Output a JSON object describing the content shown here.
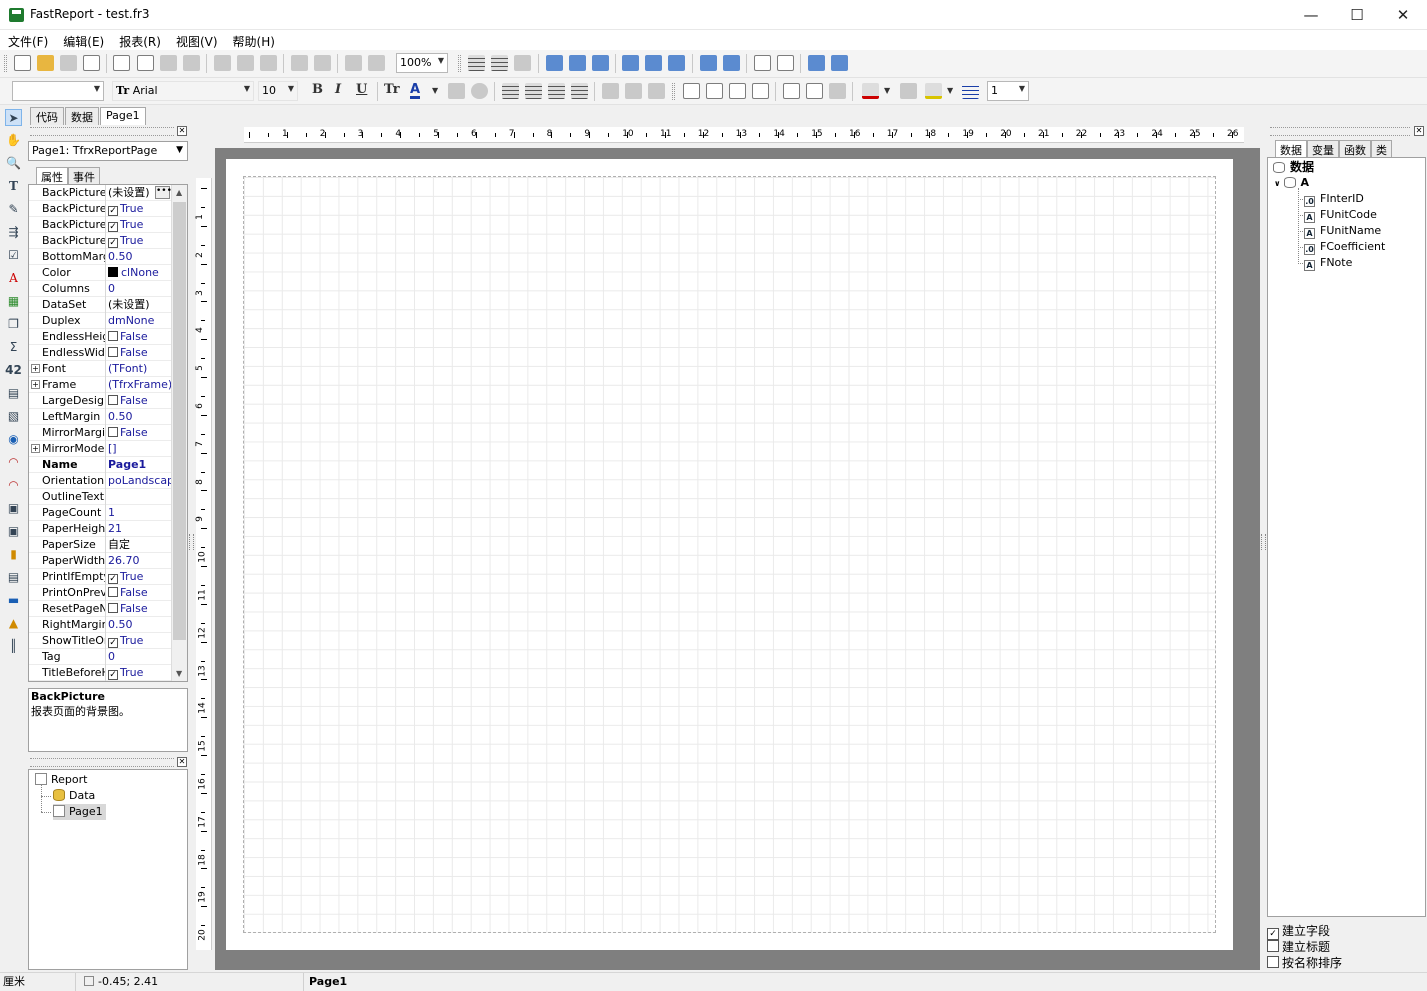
{
  "window": {
    "title": "FastReport - test.fr3"
  },
  "menu": [
    "文件(F)",
    "编辑(E)",
    "报表(R)",
    "视图(V)",
    "帮助(H)"
  ],
  "toolbar": {
    "zoom": "100%",
    "font_name": "Arial",
    "font_size": "10",
    "line_width": "1",
    "style_combo": ""
  },
  "page_tabs": [
    "代码",
    "数据",
    "Page1"
  ],
  "inspector": {
    "object_selector": "Page1: TfrxReportPage",
    "tabs": [
      "属性",
      "事件"
    ],
    "properties": [
      {
        "name": "BackPicture",
        "value": "(未设置)",
        "ellipsis": true
      },
      {
        "name": "BackPictureP",
        "value": "True",
        "check": true
      },
      {
        "name": "BackPictureS",
        "value": "True",
        "check": true
      },
      {
        "name": "BackPictureVi",
        "value": "True",
        "check": true
      },
      {
        "name": "BottomMargin",
        "value": "0.50"
      },
      {
        "name": "Color",
        "value": "clNone",
        "swatch": true
      },
      {
        "name": "Columns",
        "value": "0"
      },
      {
        "name": "DataSet",
        "value": "(未设置)"
      },
      {
        "name": "Duplex",
        "value": "dmNone"
      },
      {
        "name": "EndlessHeigh",
        "value": "False",
        "check": false
      },
      {
        "name": "EndlessWidth",
        "value": "False",
        "check": false
      },
      {
        "name": "Font",
        "value": "(TFont)",
        "expand": true
      },
      {
        "name": "Frame",
        "value": "(TfrxFrame)",
        "expand": true
      },
      {
        "name": "LargeDesignH",
        "value": "False",
        "check": false
      },
      {
        "name": "LeftMargin",
        "value": "0.50"
      },
      {
        "name": "MirrorMargins",
        "value": "False",
        "check": false
      },
      {
        "name": "MirrorMode",
        "value": "[]",
        "expand": true
      },
      {
        "name": "Name",
        "value": "Page1",
        "bold": true
      },
      {
        "name": "Orientation",
        "value": "poLandscape"
      },
      {
        "name": "OutlineText",
        "value": ""
      },
      {
        "name": "PageCount",
        "value": "1"
      },
      {
        "name": "PaperHeight",
        "value": "21"
      },
      {
        "name": "PaperSize",
        "value": "自定"
      },
      {
        "name": "PaperWidth",
        "value": "26.70"
      },
      {
        "name": "PrintIfEmpty",
        "value": "True",
        "check": true
      },
      {
        "name": "PrintOnPrevic",
        "value": "False",
        "check": false
      },
      {
        "name": "ResetPageNu",
        "value": "False",
        "check": false
      },
      {
        "name": "RightMargin",
        "value": "0.50"
      },
      {
        "name": "ShowTitleOnP",
        "value": "True",
        "check": true
      },
      {
        "name": "Tag",
        "value": "0"
      },
      {
        "name": "TitleBeforeHe",
        "value": "True",
        "check": true
      }
    ],
    "description_title": "BackPicture",
    "description_text": "报表页面的背景图。"
  },
  "report_tree": {
    "root": "Report",
    "children": [
      "Data",
      "Page1"
    ]
  },
  "rulers": {
    "horizontal": [
      "1",
      "2",
      "3",
      "4",
      "5",
      "6",
      "7",
      "8",
      "9",
      "10",
      "11",
      "12",
      "13",
      "14",
      "15",
      "16",
      "17",
      "18",
      "19",
      "20",
      "21",
      "22",
      "23",
      "24",
      "25",
      "26"
    ],
    "vertical": [
      "1",
      "2",
      "3",
      "4",
      "5",
      "6",
      "7",
      "8",
      "9",
      "10",
      "11",
      "12",
      "13",
      "14",
      "15",
      "16",
      "17",
      "18",
      "19",
      "20"
    ]
  },
  "data_panel": {
    "tabs": [
      "数据",
      "变量",
      "函数",
      "类"
    ],
    "root": "数据",
    "dataset": "A",
    "fields": [
      {
        "name": "FInterID",
        "type": ".0"
      },
      {
        "name": "FUnitCode",
        "type": "A"
      },
      {
        "name": "FUnitName",
        "type": "A"
      },
      {
        "name": "FCoefficient",
        "type": ".0"
      },
      {
        "name": "FNote",
        "type": "A"
      }
    ],
    "options": [
      {
        "label": "建立字段",
        "checked": true
      },
      {
        "label": "建立标题",
        "checked": false
      },
      {
        "label": "按名称排序",
        "checked": false
      }
    ]
  },
  "status": {
    "unit": "厘米",
    "coords": "-0.45; 2.41",
    "page": "Page1"
  }
}
